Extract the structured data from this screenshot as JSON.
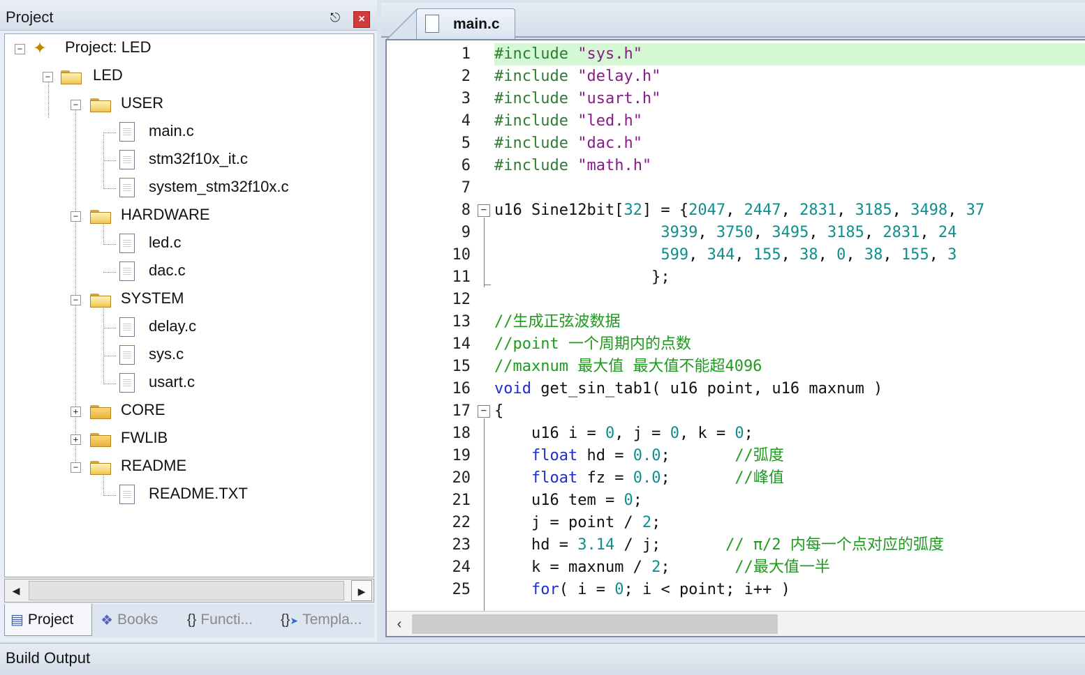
{
  "project_panel": {
    "title": "Project",
    "pin_icon": "pin-icon",
    "close_icon": "close-icon",
    "tree": {
      "root": "Project: LED",
      "target": "LED",
      "groups": [
        {
          "name": "USER",
          "expanded": true,
          "files": [
            "main.c",
            "stm32f10x_it.c",
            "system_stm32f10x.c"
          ]
        },
        {
          "name": "HARDWARE",
          "expanded": true,
          "files": [
            "led.c",
            "dac.c"
          ]
        },
        {
          "name": "SYSTEM",
          "expanded": true,
          "files": [
            "delay.c",
            "sys.c",
            "usart.c"
          ]
        },
        {
          "name": "CORE",
          "expanded": false,
          "files": []
        },
        {
          "name": "FWLIB",
          "expanded": false,
          "files": []
        },
        {
          "name": "README",
          "expanded": true,
          "files": [
            "README.TXT"
          ]
        }
      ]
    },
    "tabs": [
      {
        "label": "Project",
        "icon": "project-icon",
        "active": true
      },
      {
        "label": "Books",
        "icon": "books-icon",
        "active": false
      },
      {
        "label": "Functi...",
        "icon": "functions-icon",
        "active": false
      },
      {
        "label": "Templa...",
        "icon": "templates-icon",
        "active": false
      }
    ]
  },
  "editor": {
    "active_tab": "main.c",
    "code_lines": [
      {
        "n": "1",
        "segs": [
          [
            "kw-pre",
            "#include "
          ],
          [
            "str",
            "\"sys.h\""
          ]
        ],
        "highlight": true
      },
      {
        "n": "2",
        "segs": [
          [
            "kw-pre",
            "#include "
          ],
          [
            "str",
            "\"delay.h\""
          ]
        ]
      },
      {
        "n": "3",
        "segs": [
          [
            "kw-pre",
            "#include "
          ],
          [
            "str",
            "\"usart.h\""
          ]
        ]
      },
      {
        "n": "4",
        "segs": [
          [
            "kw-pre",
            "#include "
          ],
          [
            "str",
            "\"led.h\""
          ]
        ]
      },
      {
        "n": "5",
        "segs": [
          [
            "kw-pre",
            "#include "
          ],
          [
            "str",
            "\"dac.h\""
          ]
        ]
      },
      {
        "n": "6",
        "segs": [
          [
            "kw-pre",
            "#include "
          ],
          [
            "str",
            "\"math.h\""
          ]
        ]
      },
      {
        "n": "7",
        "segs": []
      },
      {
        "n": "8",
        "segs": [
          [
            "",
            "u16 Sine12bit["
          ],
          [
            "num",
            "32"
          ],
          [
            "",
            "] = {"
          ],
          [
            "num",
            "2047"
          ],
          [
            "",
            ", "
          ],
          [
            "num",
            "2447"
          ],
          [
            "",
            ", "
          ],
          [
            "num",
            "2831"
          ],
          [
            "",
            ", "
          ],
          [
            "num",
            "3185"
          ],
          [
            "",
            ", "
          ],
          [
            "num",
            "3498"
          ],
          [
            "",
            ", "
          ],
          [
            "num",
            "37"
          ]
        ]
      },
      {
        "n": "9",
        "segs": [
          [
            "",
            "                  "
          ],
          [
            "num",
            "3939"
          ],
          [
            "",
            ", "
          ],
          [
            "num",
            "3750"
          ],
          [
            "",
            ", "
          ],
          [
            "num",
            "3495"
          ],
          [
            "",
            ", "
          ],
          [
            "num",
            "3185"
          ],
          [
            "",
            ", "
          ],
          [
            "num",
            "2831"
          ],
          [
            "",
            ", "
          ],
          [
            "num",
            "24"
          ]
        ]
      },
      {
        "n": "10",
        "segs": [
          [
            "",
            "                  "
          ],
          [
            "num",
            "599"
          ],
          [
            "",
            ", "
          ],
          [
            "num",
            "344"
          ],
          [
            "",
            ", "
          ],
          [
            "num",
            "155"
          ],
          [
            "",
            ", "
          ],
          [
            "num",
            "38"
          ],
          [
            "",
            ", "
          ],
          [
            "num",
            "0"
          ],
          [
            "",
            ", "
          ],
          [
            "num",
            "38"
          ],
          [
            "",
            ", "
          ],
          [
            "num",
            "155"
          ],
          [
            "",
            ", "
          ],
          [
            "num",
            "3"
          ]
        ]
      },
      {
        "n": "11",
        "segs": [
          [
            "",
            "                 };"
          ]
        ]
      },
      {
        "n": "12",
        "segs": []
      },
      {
        "n": "13",
        "segs": [
          [
            "cmt",
            "//生成正弦波数据"
          ]
        ]
      },
      {
        "n": "14",
        "segs": [
          [
            "cmt",
            "//point 一个周期内的点数"
          ]
        ]
      },
      {
        "n": "15",
        "segs": [
          [
            "cmt",
            "//maxnum 最大值 最大值不能超4096"
          ]
        ]
      },
      {
        "n": "16",
        "segs": [
          [
            "kw",
            "void"
          ],
          [
            "",
            " get_sin_tab1( u16 point, u16 maxnum )"
          ]
        ]
      },
      {
        "n": "17",
        "segs": [
          [
            "",
            "{"
          ]
        ]
      },
      {
        "n": "18",
        "segs": [
          [
            "",
            "    u16 i = "
          ],
          [
            "num",
            "0"
          ],
          [
            "",
            ", j = "
          ],
          [
            "num",
            "0"
          ],
          [
            "",
            ", k = "
          ],
          [
            "num",
            "0"
          ],
          [
            "",
            ";"
          ]
        ]
      },
      {
        "n": "19",
        "segs": [
          [
            "",
            "    "
          ],
          [
            "kw",
            "float"
          ],
          [
            "",
            " hd = "
          ],
          [
            "num",
            "0.0"
          ],
          [
            "",
            ";       "
          ],
          [
            "cmt",
            "//弧度"
          ]
        ]
      },
      {
        "n": "20",
        "segs": [
          [
            "",
            "    "
          ],
          [
            "kw",
            "float"
          ],
          [
            "",
            " fz = "
          ],
          [
            "num",
            "0.0"
          ],
          [
            "",
            ";       "
          ],
          [
            "cmt",
            "//峰值"
          ]
        ]
      },
      {
        "n": "21",
        "segs": [
          [
            "",
            "    u16 tem = "
          ],
          [
            "num",
            "0"
          ],
          [
            "",
            ";"
          ]
        ]
      },
      {
        "n": "22",
        "segs": [
          [
            "",
            "    j = point / "
          ],
          [
            "num",
            "2"
          ],
          [
            "",
            ";"
          ]
        ]
      },
      {
        "n": "23",
        "segs": [
          [
            "",
            "    hd = "
          ],
          [
            "num",
            "3.14"
          ],
          [
            "",
            " / j;       "
          ],
          [
            "cmt",
            "// π/2 内每一个点对应的弧度"
          ]
        ]
      },
      {
        "n": "24",
        "segs": [
          [
            "",
            "    k = maxnum / "
          ],
          [
            "num",
            "2"
          ],
          [
            "",
            ";       "
          ],
          [
            "cmt",
            "//最大值一半"
          ]
        ]
      },
      {
        "n": "25",
        "segs": [
          [
            "",
            "    "
          ],
          [
            "kw",
            "for"
          ],
          [
            "",
            "( i = "
          ],
          [
            "num",
            "0"
          ],
          [
            "",
            "; i < point; i++ )"
          ]
        ]
      }
    ]
  },
  "build_output": {
    "title": "Build Output"
  }
}
